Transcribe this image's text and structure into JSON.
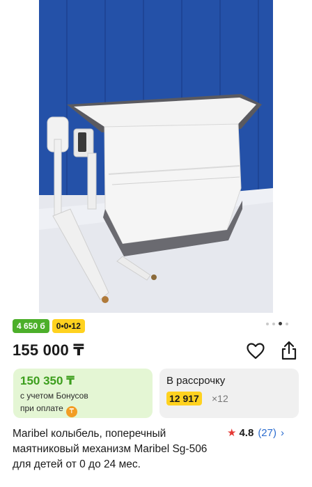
{
  "product_image": {
    "alt": "",
    "carousel_count": 4,
    "carousel_active_index": 2
  },
  "badges": {
    "bonus": "4 650 б",
    "installment": "0•0•12"
  },
  "price": "155 000 ₸",
  "icons": {
    "favorite": "heart-icon",
    "share": "share-icon",
    "rating_star": "star-icon",
    "bonus_coin": "coin-icon",
    "rating_arrow": "chevron-right-icon"
  },
  "bonus_card": {
    "price": "150 350 ₸",
    "note_line1": "с учетом Бонусов",
    "note_line2": "при оплате"
  },
  "installment_card": {
    "title": "В рассрочку",
    "amount": "12 917",
    "times": "×12"
  },
  "product_title": "Maribel колыбель, поперечный маятниковый механизм Maribel Sg-506 для детей от 0 до 24 мес.",
  "rating": {
    "value": "4.8",
    "count": "(27)"
  },
  "colors": {
    "bonus_green": "#4caf2a",
    "credit_yellow": "#ffd21f",
    "bonus_card_bg": "#e4f6d4",
    "link_blue": "#2b6ccf",
    "star_red": "#e53935"
  }
}
